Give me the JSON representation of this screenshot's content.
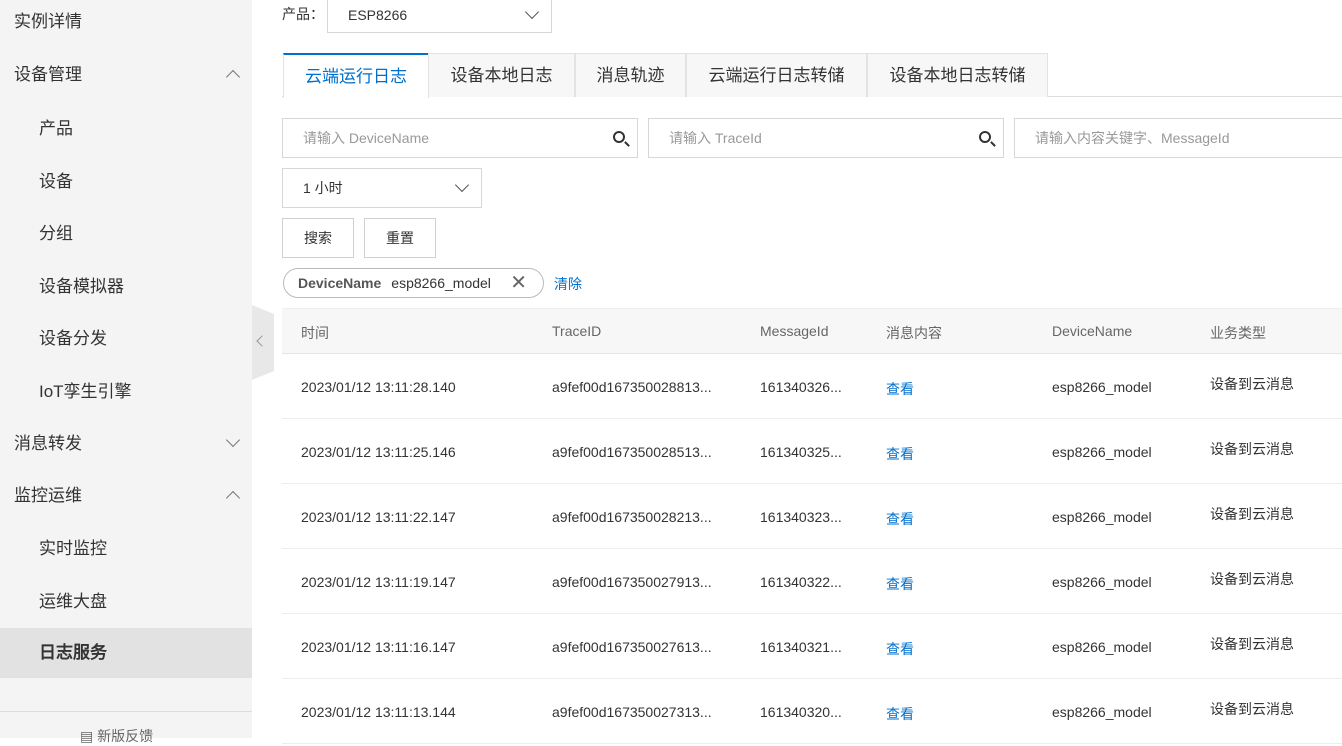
{
  "sidebar": {
    "items": [
      {
        "label": "实例详情",
        "level": 1
      },
      {
        "label": "设备管理",
        "level": 1,
        "chevron": "up"
      },
      {
        "label": "产品",
        "level": 2
      },
      {
        "label": "设备",
        "level": 2
      },
      {
        "label": "分组",
        "level": 2
      },
      {
        "label": "设备模拟器",
        "level": 2
      },
      {
        "label": "设备分发",
        "level": 2
      },
      {
        "label": "IoT孪生引擎",
        "level": 2
      },
      {
        "label": "消息转发",
        "level": 1,
        "chevron": "down"
      },
      {
        "label": "监控运维",
        "level": 1,
        "chevron": "up"
      },
      {
        "label": "实时监控",
        "level": 2
      },
      {
        "label": "运维大盘",
        "level": 2
      },
      {
        "label": "日志服务",
        "level": 2,
        "active": true
      }
    ],
    "feedback": "新版反馈"
  },
  "product": {
    "label": "产品：",
    "value": "ESP8266"
  },
  "tabs": [
    {
      "label": "云端运行日志",
      "active": true
    },
    {
      "label": "设备本地日志"
    },
    {
      "label": "消息轨迹"
    },
    {
      "label": "云端运行日志转储"
    },
    {
      "label": "设备本地日志转储"
    }
  ],
  "filters": {
    "device_placeholder": "请输入 DeviceName",
    "trace_placeholder": "请输入 TraceId",
    "keyword_placeholder": "请输入内容关键字、MessageId",
    "time_range": "1 小时",
    "search": "搜索",
    "reset": "重置"
  },
  "tag": {
    "key": "DeviceName",
    "value": "esp8266_model",
    "clear": "清除"
  },
  "table": {
    "columns": [
      "时间",
      "TraceID",
      "MessageId",
      "消息内容",
      "DeviceName",
      "业务类型"
    ],
    "rows": [
      [
        "2023/01/12 13:11:28.140",
        "a9fef00d167350028813...",
        "161340326...",
        "查看",
        "esp8266_model",
        "设备到云消息"
      ],
      [
        "2023/01/12 13:11:25.146",
        "a9fef00d167350028513...",
        "161340325...",
        "查看",
        "esp8266_model",
        "设备到云消息"
      ],
      [
        "2023/01/12 13:11:22.147",
        "a9fef00d167350028213...",
        "161340323...",
        "查看",
        "esp8266_model",
        "设备到云消息"
      ],
      [
        "2023/01/12 13:11:19.147",
        "a9fef00d167350027913...",
        "161340322...",
        "查看",
        "esp8266_model",
        "设备到云消息"
      ],
      [
        "2023/01/12 13:11:16.147",
        "a9fef00d167350027613...",
        "161340321...",
        "查看",
        "esp8266_model",
        "设备到云消息"
      ],
      [
        "2023/01/12 13:11:13.144",
        "a9fef00d167350027313...",
        "161340320...",
        "查看",
        "esp8266_model",
        "设备到云消息"
      ]
    ]
  },
  "colors": {
    "accent": "#0070cc",
    "sidebar_bg": "#f4f4f4"
  }
}
